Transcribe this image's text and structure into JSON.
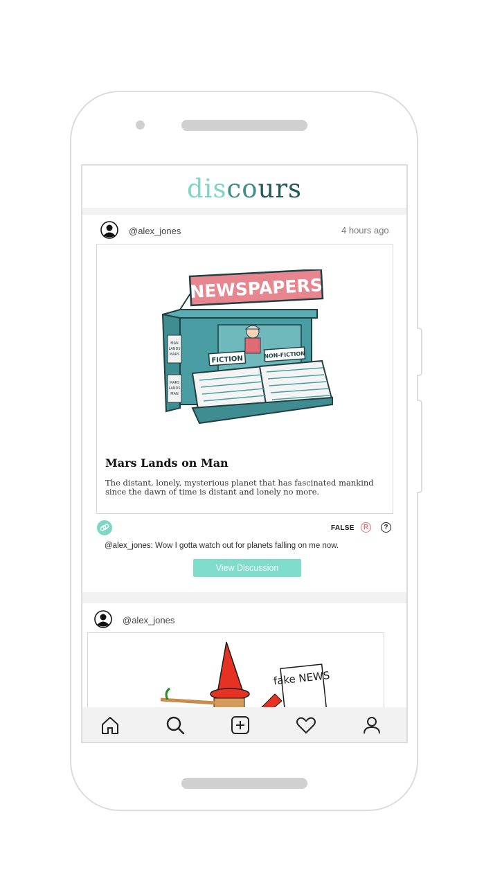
{
  "app": {
    "logo_part1": "dis",
    "logo_part2": "co",
    "logo_part3": "urs"
  },
  "posts": [
    {
      "username": "@alex_jones",
      "time": "4 hours ago",
      "title": "Mars Lands on Man",
      "description": "The distant, lonely, mysterious planet that has fascinated mankind since the dawn of time is distant and lonely no more.",
      "verdict": "FALSE",
      "comment_user": "@alex_jones:",
      "comment_text": " Wow I gotta watch out for planets falling on me now.",
      "button_label": "View Discussion",
      "image": {
        "sign": "NEWSPAPERS",
        "label_left": "FICTION",
        "label_right": "NON-FICTION",
        "side_text_top": "MAN LANDS ON MARS",
        "side_text_bottom": "MARS LANDS ON MAN"
      }
    },
    {
      "username": "@alex_jones",
      "image": {
        "paper_text": "fake NEWS"
      }
    }
  ],
  "nav": [
    "home-icon",
    "search-icon",
    "add-icon",
    "heart-icon",
    "profile-icon"
  ],
  "colors": {
    "accent": "#7fdccb",
    "false_badge": "#ee6f7a",
    "sign_pink": "#e8868f",
    "stand_teal": "#4a9ea3"
  }
}
